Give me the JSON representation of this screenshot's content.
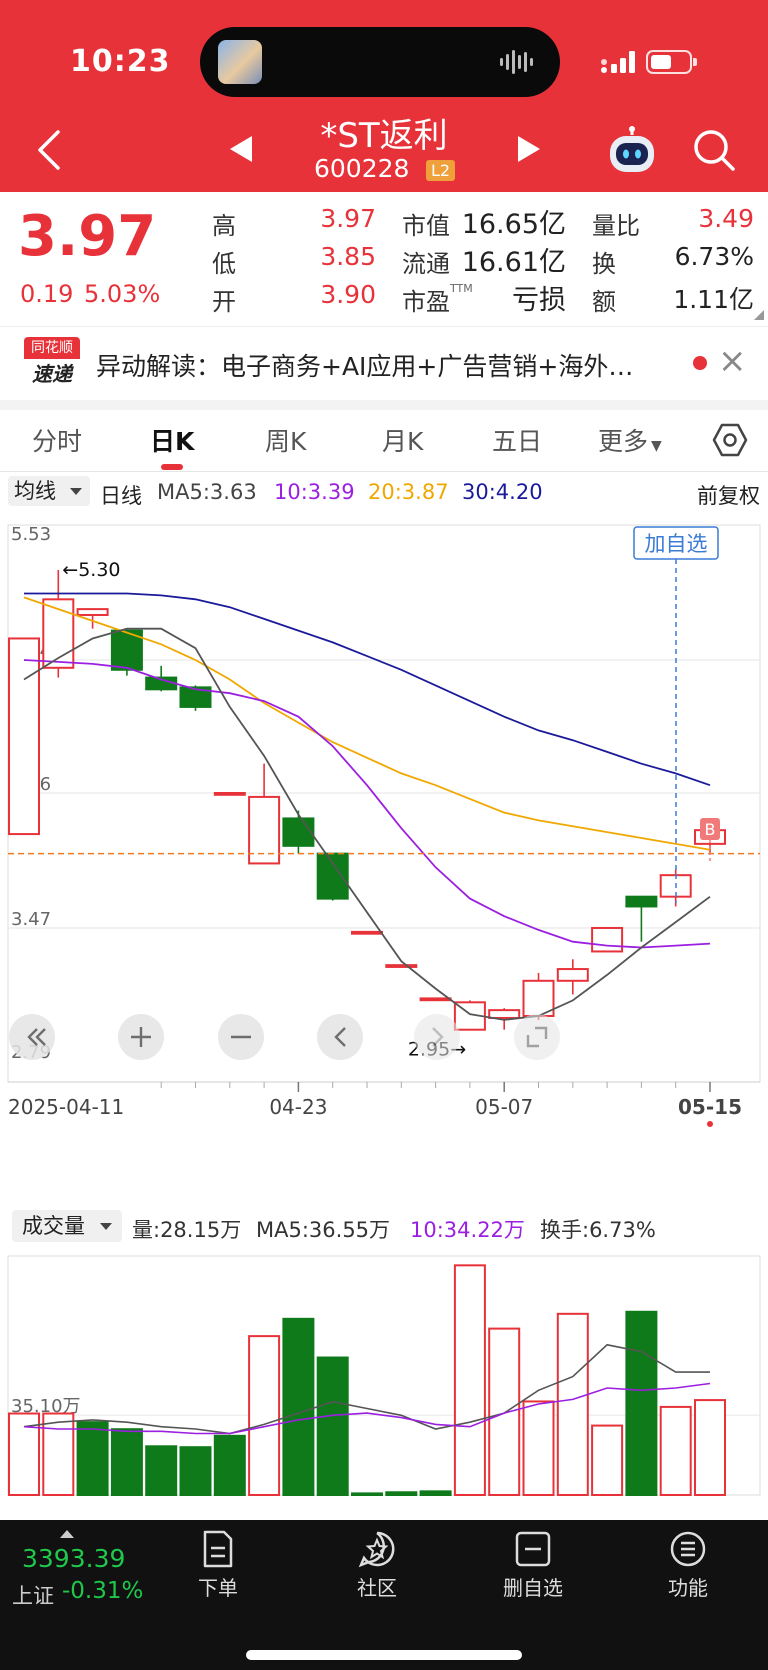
{
  "status": {
    "time": "10:23"
  },
  "header": {
    "name": "*ST返利",
    "code": "600228",
    "level": "L2"
  },
  "quote": {
    "price": "3.97",
    "change": "0.19",
    "change_pct": "5.03%",
    "high_label": "高",
    "high": "3.97",
    "low_label": "低",
    "low": "3.85",
    "open_label": "开",
    "open": "3.90",
    "mcap_label": "市值",
    "mcap": "16.65亿",
    "float_label": "流通",
    "float": "16.61亿",
    "pe_label": "市盈",
    "pe_sup": "TTM",
    "pe": "亏损",
    "vr_label": "量比",
    "vr": "3.49",
    "turn_label": "换",
    "turn": "6.73%",
    "amt_label": "额",
    "amt": "1.11亿"
  },
  "news": {
    "logo_top": "同花顺",
    "logo_bottom": "速递",
    "text": "异动解读：电子商务+AI应用+广告营销+海外…"
  },
  "tabs": [
    "分时",
    "日K",
    "周K",
    "月K",
    "五日",
    "更多"
  ],
  "active_tab": "日K",
  "ma_bar": {
    "selector": "均线",
    "period": "日线",
    "ma5": "MA5:3.63",
    "ma10": "10:3.39",
    "ma20": "20:3.87",
    "ma30": "30:4.20",
    "adjust": "前复权"
  },
  "colors": {
    "up": "#e8323a",
    "down": "#0f7a1a",
    "ma5": "#555555",
    "ma10": "#9b1fe0",
    "ma20": "#f0a800",
    "ma30": "#1a1a9a"
  },
  "chart_data": [
    {
      "type": "candlestick",
      "y_ticks": [
        "5.53",
        "4.84",
        "4.16",
        "3.47",
        "2.79"
      ],
      "ylim": [
        2.79,
        5.53
      ],
      "x_labels": [
        "2025-04-11",
        "04-23",
        "05-07",
        "05-15"
      ],
      "annotations": {
        "high": "←5.30",
        "low": "2.95→",
        "add_watch": "加自选",
        "buy_marker": "B"
      },
      "candles": [
        {
          "o": 3.95,
          "h": 4.93,
          "l": 4.82,
          "c": 4.95,
          "note": "approx"
        },
        {
          "o": 4.8,
          "h": 5.3,
          "l": 4.75,
          "c": 5.15
        },
        {
          "o": 5.07,
          "h": 5.09,
          "l": 5.0,
          "c": 5.1
        },
        {
          "o": 4.99,
          "h": 5.0,
          "l": 4.76,
          "c": 4.79
        },
        {
          "o": 4.75,
          "h": 4.81,
          "l": 4.68,
          "c": 4.69
        },
        {
          "o": 4.7,
          "h": 4.71,
          "l": 4.58,
          "c": 4.6
        },
        {
          "o": 4.16,
          "h": 4.16,
          "l": 4.16,
          "c": 4.16
        },
        {
          "o": 3.8,
          "h": 4.31,
          "l": 3.8,
          "c": 4.14
        },
        {
          "o": 4.03,
          "h": 4.07,
          "l": 3.85,
          "c": 3.89
        },
        {
          "o": 3.85,
          "h": 3.85,
          "l": 3.61,
          "c": 3.62
        },
        {
          "o": 3.45,
          "h": 3.45,
          "l": 3.45,
          "c": 3.45
        },
        {
          "o": 3.28,
          "h": 3.28,
          "l": 3.28,
          "c": 3.28
        },
        {
          "o": 3.11,
          "h": 3.11,
          "l": 3.11,
          "c": 3.11
        },
        {
          "o": 2.95,
          "h": 3.1,
          "l": 2.95,
          "c": 3.09
        },
        {
          "o": 3.01,
          "h": 3.06,
          "l": 2.95,
          "c": 3.05
        },
        {
          "o": 3.02,
          "h": 3.24,
          "l": 3.0,
          "c": 3.2
        },
        {
          "o": 3.2,
          "h": 3.31,
          "l": 3.13,
          "c": 3.26
        },
        {
          "o": 3.35,
          "h": 3.47,
          "l": 3.35,
          "c": 3.47
        },
        {
          "o": 3.63,
          "h": 3.63,
          "l": 3.4,
          "c": 3.58
        },
        {
          "o": 3.63,
          "h": 3.77,
          "l": 3.58,
          "c": 3.74
        },
        {
          "o": 3.9,
          "h": 3.97,
          "l": 3.85,
          "c": 3.97
        }
      ],
      "ma5": [
        4.74,
        4.85,
        4.95,
        5.0,
        5.0,
        4.9,
        4.6,
        4.35,
        4.05,
        3.8,
        3.55,
        3.3,
        3.16,
        3.03,
        3.0,
        3.02,
        3.1,
        3.23,
        3.37,
        3.5,
        3.63
      ],
      "ma10": [
        4.84,
        4.83,
        4.82,
        4.8,
        4.74,
        4.69,
        4.67,
        4.63,
        4.55,
        4.4,
        4.2,
        3.98,
        3.78,
        3.62,
        3.53,
        3.46,
        3.4,
        3.38,
        3.37,
        3.38,
        3.39
      ],
      "ma20": [
        5.16,
        5.1,
        5.04,
        4.98,
        4.92,
        4.84,
        4.74,
        4.62,
        4.52,
        4.42,
        4.34,
        4.26,
        4.2,
        4.13,
        4.06,
        4.02,
        3.99,
        3.96,
        3.93,
        3.9,
        3.87
      ],
      "ma30": [
        5.18,
        5.18,
        5.18,
        5.18,
        5.17,
        5.15,
        5.11,
        5.05,
        4.99,
        4.93,
        4.86,
        4.79,
        4.71,
        4.63,
        4.55,
        4.48,
        4.43,
        4.37,
        4.31,
        4.26,
        4.2
      ]
    },
    {
      "type": "bar",
      "name": "成交量",
      "y_tick": "35.10万",
      "values": [
        35.8,
        35.8,
        32.0,
        28.9,
        21.4,
        21.0,
        26.0,
        69.8,
        77.4,
        60.4,
        0.7,
        1.2,
        1.6,
        100.9,
        73.1,
        41.1,
        79.6,
        30.5,
        80.5,
        38.7,
        41.7
      ],
      "colors": [
        "up",
        "up",
        "down",
        "down",
        "down",
        "down",
        "down",
        "up",
        "down",
        "down",
        "down",
        "down",
        "down",
        "up",
        "up",
        "up",
        "up",
        "up",
        "down",
        "up",
        "up"
      ],
      "ma5": [
        30,
        32,
        33,
        32,
        30,
        29,
        27,
        31,
        36,
        41,
        38,
        35,
        29,
        32,
        36,
        46,
        52,
        66,
        63,
        54,
        54
      ],
      "ma10": [
        30,
        29,
        29,
        28,
        28,
        27,
        27,
        30,
        33,
        35,
        36,
        34,
        31,
        30,
        36,
        40,
        42,
        47,
        46,
        47,
        49
      ]
    }
  ],
  "volume_bar": {
    "selector": "成交量",
    "vol": "量:28.15万",
    "ma5": "MA5:36.55万",
    "ma10": "10:34.22万",
    "turnover": "换手:6.73%"
  },
  "bottom_bar": {
    "index_value": "3393.39",
    "index_name": "上证",
    "index_pct": "-0.31%",
    "items": [
      "下单",
      "社区",
      "删自选",
      "功能"
    ]
  }
}
